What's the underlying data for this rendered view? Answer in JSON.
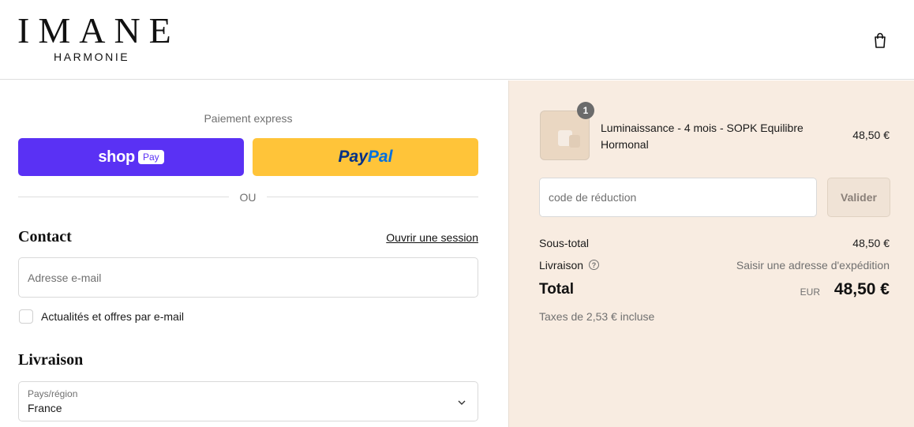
{
  "header": {
    "logo_main": "IMANE",
    "logo_sub": "HARMONIE",
    "cart_icon": "shopping-bag-icon"
  },
  "express": {
    "label": "Paiement express",
    "shop_pay": {
      "word": "shop",
      "pay": "Pay"
    },
    "paypal": {
      "pay": "Pay",
      "pal": "Pal"
    },
    "divider": "OU"
  },
  "contact": {
    "title": "Contact",
    "login_link": "Ouvrir une session",
    "email_placeholder": "Adresse e-mail",
    "newsletter_label": "Actualités et offres par e-mail",
    "newsletter_checked": false
  },
  "delivery": {
    "title": "Livraison",
    "country_label": "Pays/région",
    "country_value": "France"
  },
  "summary": {
    "quantity": "1",
    "product_name": "Luminaissance - 4 mois - SOPK Equilibre Hormonal",
    "product_price": "48,50 €",
    "discount_placeholder": "code de réduction",
    "validate_label": "Valider",
    "subtotal_label": "Sous-total",
    "subtotal_value": "48,50 €",
    "shipping_label": "Livraison",
    "shipping_value": "Saisir une adresse d'expédition",
    "total_label": "Total",
    "total_currency": "EUR",
    "total_value": "48,50 €",
    "tax_note": "Taxes de 2,53 € incluse"
  },
  "colors": {
    "shop_pay": "#5a31f4",
    "paypal": "#ffc439",
    "summary_bg": "#f8ece1"
  }
}
